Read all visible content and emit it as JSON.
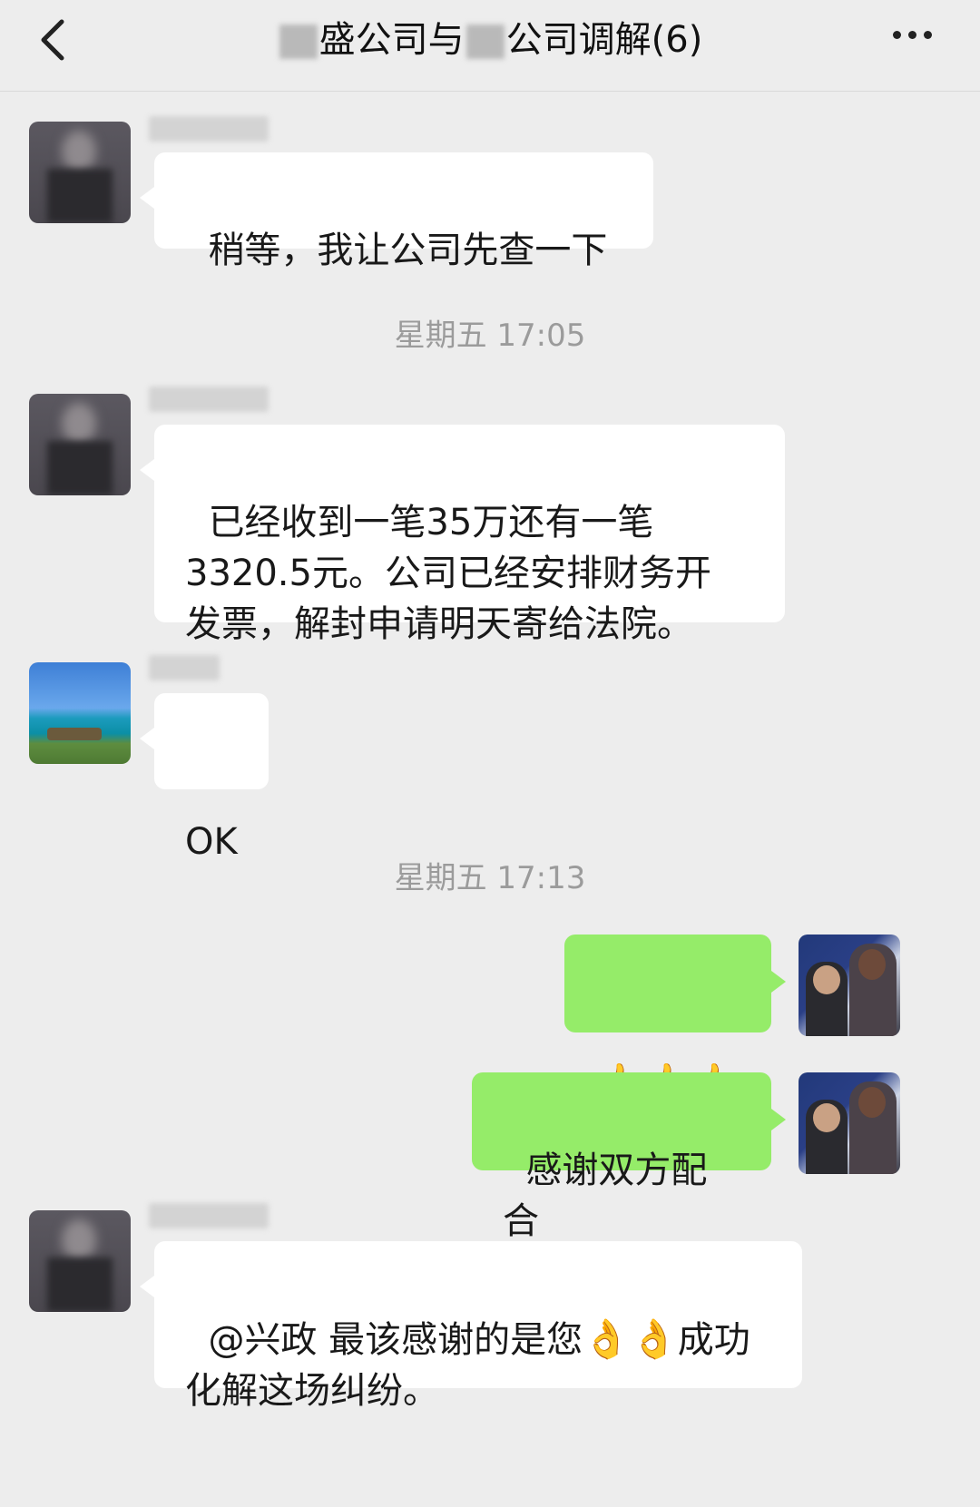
{
  "header": {
    "title_part1": "盛公司与",
    "title_part2": "公司调解(6)"
  },
  "messages": [
    {
      "text": "稍等，我让公司先查一下"
    },
    {
      "timestamp": "星期五 17:05"
    },
    {
      "text": "已经收到一笔35万还有一笔\n3320.5元。公司已经安排财务开\n发票，解封申请明天寄给法院。"
    },
    {
      "text": "OK"
    },
    {
      "timestamp": "星期五 17:13"
    },
    {
      "text": "👍👍👍"
    },
    {
      "text": "感谢双方配合"
    },
    {
      "text_a": "@兴政 最该感谢的是您",
      "emoji": "👌👌",
      "text_b": "成功\n化解这场纠纷。"
    }
  ]
}
